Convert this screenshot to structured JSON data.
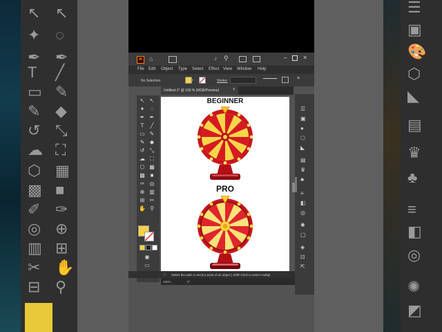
{
  "app": {
    "logo_text": "Ai"
  },
  "menu": [
    "File",
    "Edit",
    "Object",
    "Type",
    "Select",
    "Effect",
    "View",
    "Window",
    "Help"
  ],
  "control_bar": {
    "selection_label": "No Selection",
    "stroke_label": "Stroke:"
  },
  "document_tab": {
    "title": "Untitled-1* @ 100 % (RGB/Preview)",
    "close": "×"
  },
  "artboard": {
    "beginner_label": "BEGINNER",
    "pro_label": "PRO"
  },
  "status": {
    "hint": "Select the path or anchor point of an object  |  Shift+Click to select multipl"
  },
  "bottom": {
    "zoom": "100%",
    "angle": "0°"
  },
  "colors": {
    "fill": "#f5d14a",
    "wheel_red": "#c8161e",
    "wheel_yellow": "#f7d64a",
    "ui_dark": "#3c3c3c"
  }
}
